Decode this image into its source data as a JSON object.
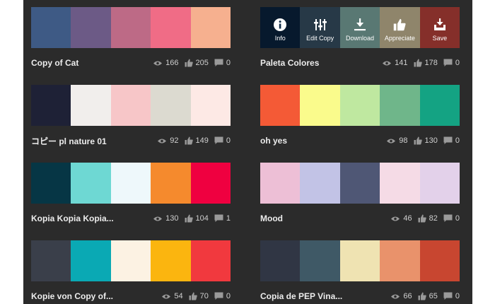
{
  "palettes": [
    {
      "title": "Copy of Cat",
      "colors": [
        "#3e5a85",
        "#6c5a86",
        "#bd6a86",
        "#f06c86",
        "#f6b08f"
      ],
      "views": "166",
      "likes": "205",
      "comments": "0"
    },
    {
      "title": "Paleta Colores",
      "colors": [
        "#0d2a45",
        "#2e4b62",
        "#7fb1a8",
        "#d6c69c",
        "#c53a32"
      ],
      "views": "141",
      "likes": "178",
      "comments": "0",
      "hover_actions": [
        {
          "icon": "info-icon",
          "label": "Info"
        },
        {
          "icon": "sliders-icon",
          "label": "Edit Copy"
        },
        {
          "icon": "download-icon",
          "label": "Download"
        },
        {
          "icon": "thumbs-up-icon",
          "label": "Appreciate"
        },
        {
          "icon": "save-icon",
          "label": "Save"
        }
      ]
    },
    {
      "title": "コピー pl nature 01",
      "colors": [
        "#1e2136",
        "#f1eeec",
        "#f7c6c8",
        "#dcdad0",
        "#fde9e5"
      ],
      "views": "92",
      "likes": "149",
      "comments": "0"
    },
    {
      "title": "oh yes",
      "colors": [
        "#f45a36",
        "#fafb8c",
        "#bfe8a0",
        "#6fb68a",
        "#14a383"
      ],
      "views": "98",
      "likes": "130",
      "comments": "0"
    },
    {
      "title": "Kopia Kopia Kopia...",
      "colors": [
        "#063645",
        "#6ed8d3",
        "#eef8fb",
        "#f58a2d",
        "#ef0040"
      ],
      "views": "130",
      "likes": "104",
      "comments": "1"
    },
    {
      "title": "Mood",
      "colors": [
        "#edbfd6",
        "#c2c3e6",
        "#4f5775",
        "#f5dbe6",
        "#e3d1ea"
      ],
      "views": "46",
      "likes": "82",
      "comments": "0"
    },
    {
      "title": "Kopie von Copy of...",
      "colors": [
        "#3a3f4a",
        "#0aa9b4",
        "#fcf2e3",
        "#fbb50f",
        "#f1393e"
      ],
      "views": "54",
      "likes": "70",
      "comments": "0"
    },
    {
      "title": "Copia de PEP Vina...",
      "colors": [
        "#303644",
        "#3f5966",
        "#efe3b2",
        "#e9926b",
        "#c84630"
      ],
      "views": "66",
      "likes": "65",
      "comments": "0"
    }
  ],
  "colors": {
    "panel_bg": "#2b2b2b",
    "text": "#ececec",
    "stat_text": "#cfcfcf",
    "icon": "#9a9a9a"
  }
}
